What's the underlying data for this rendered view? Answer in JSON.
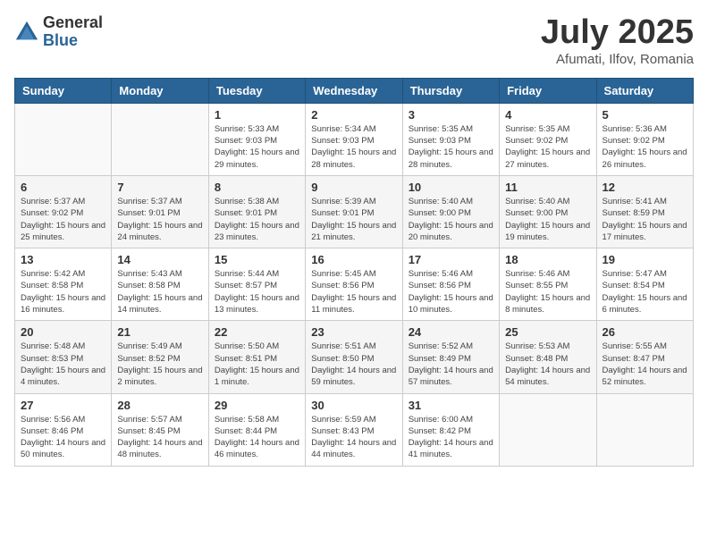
{
  "logo": {
    "general": "General",
    "blue": "Blue"
  },
  "title": "July 2025",
  "subtitle": "Afumati, Ilfov, Romania",
  "days_of_week": [
    "Sunday",
    "Monday",
    "Tuesday",
    "Wednesday",
    "Thursday",
    "Friday",
    "Saturday"
  ],
  "weeks": [
    [
      {
        "day": "",
        "info": ""
      },
      {
        "day": "",
        "info": ""
      },
      {
        "day": "1",
        "info": "Sunrise: 5:33 AM\nSunset: 9:03 PM\nDaylight: 15 hours and 29 minutes."
      },
      {
        "day": "2",
        "info": "Sunrise: 5:34 AM\nSunset: 9:03 PM\nDaylight: 15 hours and 28 minutes."
      },
      {
        "day": "3",
        "info": "Sunrise: 5:35 AM\nSunset: 9:03 PM\nDaylight: 15 hours and 28 minutes."
      },
      {
        "day": "4",
        "info": "Sunrise: 5:35 AM\nSunset: 9:02 PM\nDaylight: 15 hours and 27 minutes."
      },
      {
        "day": "5",
        "info": "Sunrise: 5:36 AM\nSunset: 9:02 PM\nDaylight: 15 hours and 26 minutes."
      }
    ],
    [
      {
        "day": "6",
        "info": "Sunrise: 5:37 AM\nSunset: 9:02 PM\nDaylight: 15 hours and 25 minutes."
      },
      {
        "day": "7",
        "info": "Sunrise: 5:37 AM\nSunset: 9:01 PM\nDaylight: 15 hours and 24 minutes."
      },
      {
        "day": "8",
        "info": "Sunrise: 5:38 AM\nSunset: 9:01 PM\nDaylight: 15 hours and 23 minutes."
      },
      {
        "day": "9",
        "info": "Sunrise: 5:39 AM\nSunset: 9:01 PM\nDaylight: 15 hours and 21 minutes."
      },
      {
        "day": "10",
        "info": "Sunrise: 5:40 AM\nSunset: 9:00 PM\nDaylight: 15 hours and 20 minutes."
      },
      {
        "day": "11",
        "info": "Sunrise: 5:40 AM\nSunset: 9:00 PM\nDaylight: 15 hours and 19 minutes."
      },
      {
        "day": "12",
        "info": "Sunrise: 5:41 AM\nSunset: 8:59 PM\nDaylight: 15 hours and 17 minutes."
      }
    ],
    [
      {
        "day": "13",
        "info": "Sunrise: 5:42 AM\nSunset: 8:58 PM\nDaylight: 15 hours and 16 minutes."
      },
      {
        "day": "14",
        "info": "Sunrise: 5:43 AM\nSunset: 8:58 PM\nDaylight: 15 hours and 14 minutes."
      },
      {
        "day": "15",
        "info": "Sunrise: 5:44 AM\nSunset: 8:57 PM\nDaylight: 15 hours and 13 minutes."
      },
      {
        "day": "16",
        "info": "Sunrise: 5:45 AM\nSunset: 8:56 PM\nDaylight: 15 hours and 11 minutes."
      },
      {
        "day": "17",
        "info": "Sunrise: 5:46 AM\nSunset: 8:56 PM\nDaylight: 15 hours and 10 minutes."
      },
      {
        "day": "18",
        "info": "Sunrise: 5:46 AM\nSunset: 8:55 PM\nDaylight: 15 hours and 8 minutes."
      },
      {
        "day": "19",
        "info": "Sunrise: 5:47 AM\nSunset: 8:54 PM\nDaylight: 15 hours and 6 minutes."
      }
    ],
    [
      {
        "day": "20",
        "info": "Sunrise: 5:48 AM\nSunset: 8:53 PM\nDaylight: 15 hours and 4 minutes."
      },
      {
        "day": "21",
        "info": "Sunrise: 5:49 AM\nSunset: 8:52 PM\nDaylight: 15 hours and 2 minutes."
      },
      {
        "day": "22",
        "info": "Sunrise: 5:50 AM\nSunset: 8:51 PM\nDaylight: 15 hours and 1 minute."
      },
      {
        "day": "23",
        "info": "Sunrise: 5:51 AM\nSunset: 8:50 PM\nDaylight: 14 hours and 59 minutes."
      },
      {
        "day": "24",
        "info": "Sunrise: 5:52 AM\nSunset: 8:49 PM\nDaylight: 14 hours and 57 minutes."
      },
      {
        "day": "25",
        "info": "Sunrise: 5:53 AM\nSunset: 8:48 PM\nDaylight: 14 hours and 54 minutes."
      },
      {
        "day": "26",
        "info": "Sunrise: 5:55 AM\nSunset: 8:47 PM\nDaylight: 14 hours and 52 minutes."
      }
    ],
    [
      {
        "day": "27",
        "info": "Sunrise: 5:56 AM\nSunset: 8:46 PM\nDaylight: 14 hours and 50 minutes."
      },
      {
        "day": "28",
        "info": "Sunrise: 5:57 AM\nSunset: 8:45 PM\nDaylight: 14 hours and 48 minutes."
      },
      {
        "day": "29",
        "info": "Sunrise: 5:58 AM\nSunset: 8:44 PM\nDaylight: 14 hours and 46 minutes."
      },
      {
        "day": "30",
        "info": "Sunrise: 5:59 AM\nSunset: 8:43 PM\nDaylight: 14 hours and 44 minutes."
      },
      {
        "day": "31",
        "info": "Sunrise: 6:00 AM\nSunset: 8:42 PM\nDaylight: 14 hours and 41 minutes."
      },
      {
        "day": "",
        "info": ""
      },
      {
        "day": "",
        "info": ""
      }
    ]
  ]
}
